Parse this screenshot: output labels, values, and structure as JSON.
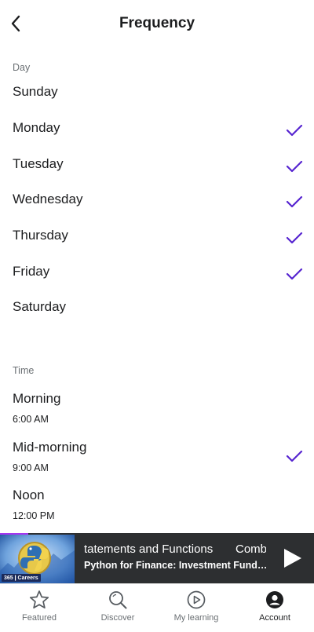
{
  "header": {
    "title": "Frequency"
  },
  "day_section": {
    "label": "Day",
    "days": [
      {
        "name": "Sunday",
        "checked": false
      },
      {
        "name": "Monday",
        "checked": true
      },
      {
        "name": "Tuesday",
        "checked": true
      },
      {
        "name": "Wednesday",
        "checked": true
      },
      {
        "name": "Thursday",
        "checked": true
      },
      {
        "name": "Friday",
        "checked": true
      },
      {
        "name": "Saturday",
        "checked": false
      }
    ]
  },
  "time_section": {
    "label": "Time",
    "times": [
      {
        "name": "Morning",
        "time": "6:00 AM",
        "checked": false
      },
      {
        "name": "Mid-morning",
        "time": "9:00 AM",
        "checked": true
      },
      {
        "name": "Noon",
        "time": "12:00 PM",
        "checked": false
      }
    ]
  },
  "player": {
    "thumb_brand": "365❙Careers",
    "lecture_title_part1": "tatements and Functions",
    "lecture_title_part2": "Comb",
    "course_title": "Python for Finance: Investment Fundamentals & Data Analytics"
  },
  "tabs": [
    {
      "label": "Featured",
      "icon": "star-icon",
      "active": false
    },
    {
      "label": "Discover",
      "icon": "search-icon",
      "active": false
    },
    {
      "label": "My learning",
      "icon": "play-circle-icon",
      "active": false
    },
    {
      "label": "Account",
      "icon": "account-icon",
      "active": true
    }
  ],
  "colors": {
    "check": "#5624d0",
    "text": "#1c1d1f",
    "muted": "#6a6f73",
    "player_bg": "#2d2f31"
  }
}
